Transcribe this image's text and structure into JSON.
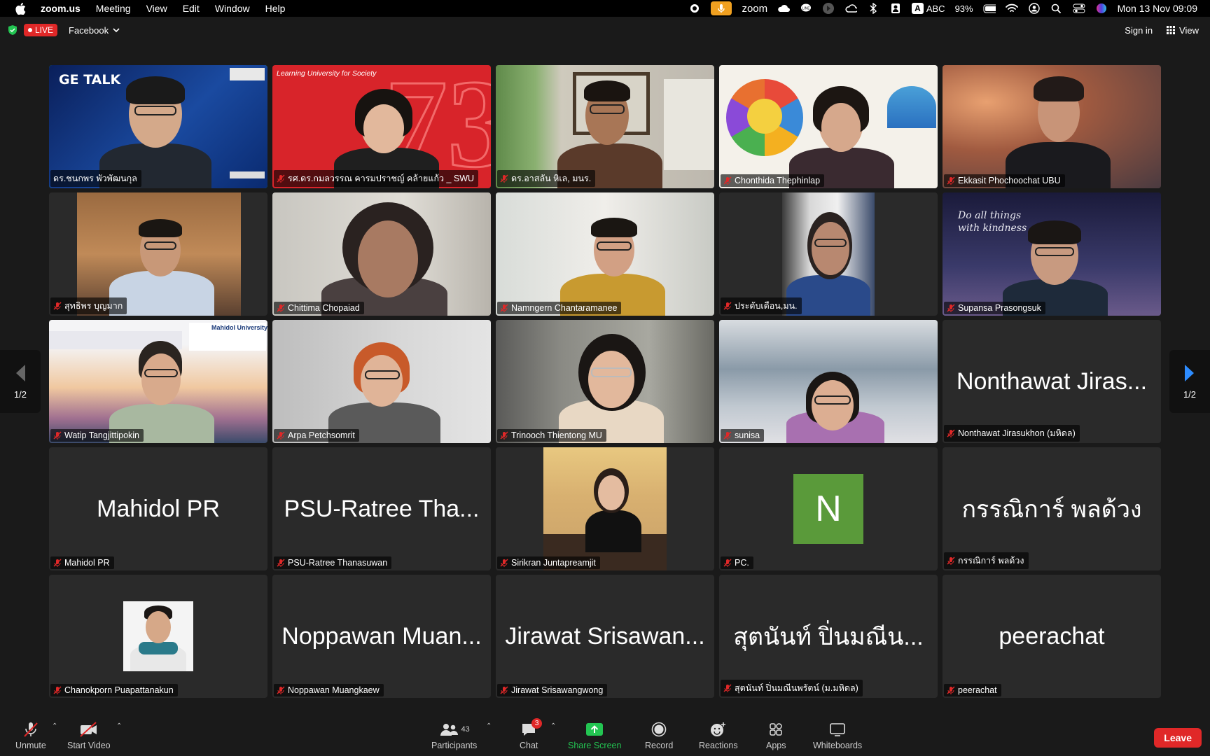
{
  "menubar": {
    "app_name": "zoom.us",
    "items": [
      "Meeting",
      "View",
      "Edit",
      "Window",
      "Help"
    ],
    "zoom_label": "zoom",
    "input_source": "ABC",
    "input_badge": "A",
    "battery": "93%",
    "datetime": "Mon 13 Nov  09:09"
  },
  "topbar": {
    "live_label": "LIVE",
    "stream_target": "Facebook",
    "sign_in": "Sign in",
    "view": "View"
  },
  "page_indicator": "1/2",
  "participants": [
    {
      "name": "ดร.ชนกพร พัวพัฒนกุล",
      "type": "video",
      "active": true,
      "banner": "GE TALK"
    },
    {
      "name": "รศ.ดร.กมลวรรณ คารมปราชญ์ คล้ายแก้ว _ SWU",
      "type": "video",
      "banner": "Learning University for Society",
      "overlay_number": "73"
    },
    {
      "name": "ดร.อาสลัน หิเล, มนร.",
      "type": "video"
    },
    {
      "name": "Chonthida Thephinlap",
      "type": "video"
    },
    {
      "name": "Ekkasit Phochoochat UBU",
      "type": "video"
    },
    {
      "name": "สุทธิพร บุญมาก",
      "type": "video"
    },
    {
      "name": "Chittima Chopaiad",
      "type": "video"
    },
    {
      "name": "Namngern Chantaramanee",
      "type": "video"
    },
    {
      "name": "ประดับเดือน,มน.",
      "type": "video"
    },
    {
      "name": "Supansa Prasongsuk",
      "type": "video",
      "overlay_text": "Do all things with kindness"
    },
    {
      "name": "Watip Tangjittipokin",
      "type": "video",
      "banner": "Mahidol University"
    },
    {
      "name": "Arpa Petchsomrit",
      "type": "video"
    },
    {
      "name": "Trinooch Thientong MU",
      "type": "video"
    },
    {
      "name": "sunisa",
      "type": "video"
    },
    {
      "name": "Nonthawat Jirasukhon (มหิดล)",
      "type": "name",
      "display": "Nonthawat Jiras..."
    },
    {
      "name": "Mahidol PR",
      "type": "name",
      "display": "Mahidol PR"
    },
    {
      "name": "PSU-Ratree Thanasuwan",
      "type": "name",
      "display": "PSU-Ratree Tha..."
    },
    {
      "name": "Sirikran Juntapreamjit",
      "type": "photo"
    },
    {
      "name": "PC.",
      "type": "initial",
      "display": "N",
      "color": "#5a9a3a"
    },
    {
      "name": "กรรณิการ์ พลด้วง",
      "type": "name",
      "display": "กรรณิการ์ พลด้วง"
    },
    {
      "name": "Chanokporn Puapattanakun",
      "type": "photo"
    },
    {
      "name": "Noppawan Muangkaew",
      "type": "name",
      "display": "Noppawan Muan..."
    },
    {
      "name": "Jirawat Srisawangwong",
      "type": "name",
      "display": "Jirawat Srisawan..."
    },
    {
      "name": "สุตนันท์ ปิ่นมณีนพรัตน์ (ม.มหิดล)",
      "type": "name",
      "display": "สุตนันท์ ปิ่นมณีน..."
    },
    {
      "name": "peerachat",
      "type": "name",
      "display": "peerachat"
    }
  ],
  "toolbar": {
    "unmute": "Unmute",
    "start_video": "Start Video",
    "participants": "Participants",
    "participant_count": "43",
    "chat": "Chat",
    "chat_badge": "3",
    "share_screen": "Share Screen",
    "record": "Record",
    "reactions": "Reactions",
    "apps": "Apps",
    "whiteboards": "Whiteboards",
    "leave": "Leave"
  },
  "colors": {
    "active_speaker": "#23c552",
    "leave": "#e02828",
    "share": "#23c552",
    "live": "#e02828"
  }
}
